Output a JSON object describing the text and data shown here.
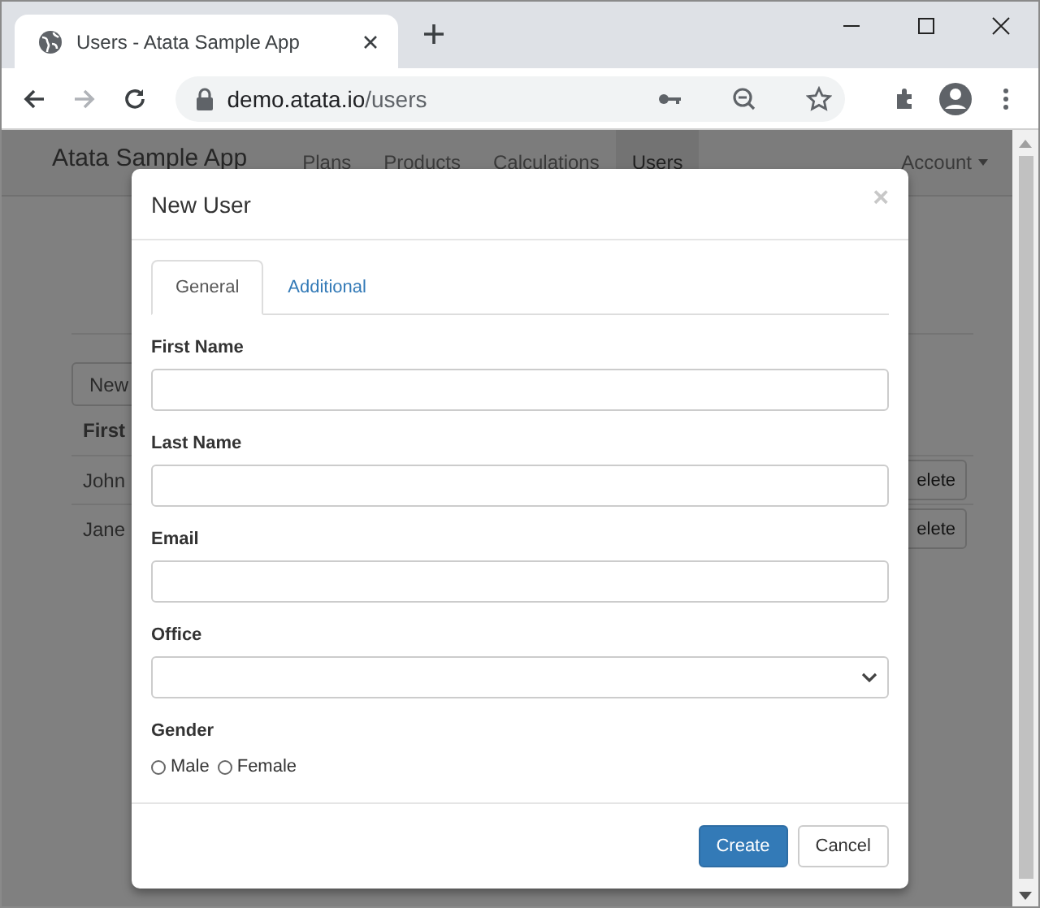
{
  "browser": {
    "tab": {
      "title": "Users - Atata Sample App",
      "selected": true
    },
    "url_host": "demo.atata.io",
    "url_path": "/users"
  },
  "navbar": {
    "brand": "Atata Sample App",
    "links": [
      {
        "label": "Plans",
        "selected": false
      },
      {
        "label": "Products",
        "selected": false
      },
      {
        "label": "Calculations",
        "selected": false
      },
      {
        "label": "Users",
        "selected": true
      }
    ],
    "account": "Account"
  },
  "page": {
    "new_button": "New",
    "table": {
      "header": "First",
      "rows": [
        {
          "name": "John",
          "action": "elete"
        },
        {
          "name": "Jane",
          "action": "elete"
        }
      ]
    }
  },
  "modal": {
    "title": "New User",
    "close": "×",
    "tabs": [
      {
        "label": "General",
        "selected": true
      },
      {
        "label": "Additional",
        "selected": false
      }
    ],
    "fields": [
      {
        "label": "First Name",
        "kind": "text"
      },
      {
        "label": "Last Name",
        "kind": "text"
      },
      {
        "label": "Email",
        "kind": "text"
      },
      {
        "label": "Office",
        "kind": "select"
      },
      {
        "label": "Gender",
        "kind": "radio",
        "options": [
          {
            "label": "Male",
            "selected": false
          },
          {
            "label": "Female",
            "selected": false
          }
        ]
      }
    ],
    "buttons": [
      {
        "label": "Create",
        "kind": "primary"
      },
      {
        "label": "Cancel",
        "kind": "default"
      }
    ]
  }
}
